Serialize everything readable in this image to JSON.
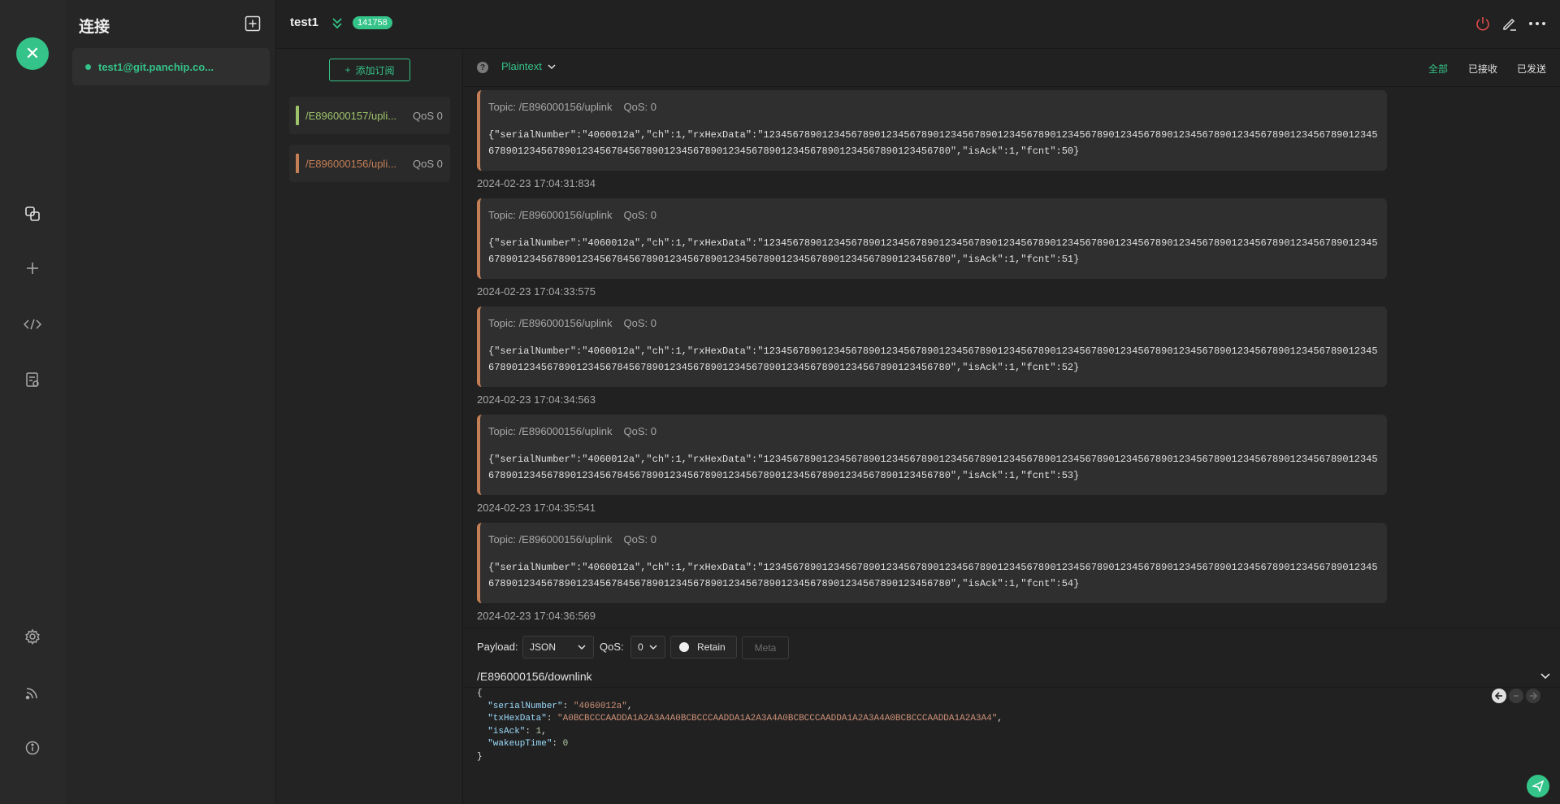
{
  "app": {
    "logo_glyph": "✕",
    "accent": "#34c388"
  },
  "nav": {
    "icons": [
      "connections-icon",
      "new-connection-icon",
      "script-icon",
      "log-icon",
      "settings-icon",
      "subscription-feed-icon",
      "about-icon"
    ]
  },
  "connections": {
    "title": "连接",
    "items": [
      {
        "name": "test1@git.panchip.co...",
        "status": "connected",
        "status_color": "#34c388"
      }
    ]
  },
  "header": {
    "title": "test1",
    "message_count": "141758"
  },
  "subscriptions": {
    "add_label": "添加订阅",
    "items": [
      {
        "topic": "/E896000157/uplink",
        "topic_display": "/E896000157/upli...",
        "qos": "QoS 0",
        "color": "#9ec46b"
      },
      {
        "topic": "/E896000156/uplink",
        "topic_display": "/E896000156/upli...",
        "qos": "QoS 0",
        "color": "#c47f56"
      }
    ]
  },
  "toolbar": {
    "format": "Plaintext",
    "filters": [
      "全部",
      "已接收",
      "已发送"
    ],
    "active_filter": "全部"
  },
  "messages": [
    {
      "topic": "Topic: /E896000156/uplink",
      "qos": "QoS: 0",
      "payload": "{\"serialNumber\":\"4060012a\",\"ch\":1,\"rxHexData\":\"1234567890123456789012345678901234567890123456789012345678901234567890123456789012345678901234567890123456789012345678901234567845678901234567890123456789012345678901234567890123456780\",\"isAck\":1,\"fcnt\":50}",
      "time": "2024-02-23 17:04:31:834"
    },
    {
      "topic": "Topic: /E896000156/uplink",
      "qos": "QoS: 0",
      "payload": "{\"serialNumber\":\"4060012a\",\"ch\":1,\"rxHexData\":\"1234567890123456789012345678901234567890123456789012345678901234567890123456789012345678901234567890123456789012345678901234567845678901234567890123456789012345678901234567890123456780\",\"isAck\":1,\"fcnt\":51}",
      "time": "2024-02-23 17:04:33:575"
    },
    {
      "topic": "Topic: /E896000156/uplink",
      "qos": "QoS: 0",
      "payload": "{\"serialNumber\":\"4060012a\",\"ch\":1,\"rxHexData\":\"1234567890123456789012345678901234567890123456789012345678901234567890123456789012345678901234567890123456789012345678901234567845678901234567890123456789012345678901234567890123456780\",\"isAck\":1,\"fcnt\":52}",
      "time": "2024-02-23 17:04:34:563"
    },
    {
      "topic": "Topic: /E896000156/uplink",
      "qos": "QoS: 0",
      "payload": "{\"serialNumber\":\"4060012a\",\"ch\":1,\"rxHexData\":\"1234567890123456789012345678901234567890123456789012345678901234567890123456789012345678901234567890123456789012345678901234567845678901234567890123456789012345678901234567890123456780\",\"isAck\":1,\"fcnt\":53}",
      "time": "2024-02-23 17:04:35:541"
    },
    {
      "topic": "Topic: /E896000156/uplink",
      "qos": "QoS: 0",
      "payload": "{\"serialNumber\":\"4060012a\",\"ch\":1,\"rxHexData\":\"1234567890123456789012345678901234567890123456789012345678901234567890123456789012345678901234567890123456789012345678901234567845678901234567890123456789012345678901234567890123456780\",\"isAck\":1,\"fcnt\":54}",
      "time": "2024-02-23 17:04:36:569"
    }
  ],
  "publish": {
    "payload_label": "Payload:",
    "payload_format": "JSON",
    "qos_label": "QoS:",
    "qos_value": "0",
    "retain_label": "Retain",
    "meta_label": "Meta",
    "topic": "/E896000156/downlink",
    "editor_lines": [
      "{",
      "  \"serialNumber\": \"4060012a\",",
      "  \"txHexData\": \"A0BCBCCCAADDA1A2A3A4A0BCBCCCAADDA1A2A3A4A0BCBCCCAADDA1A2A3A4A0BCBCCCAADDA1A2A3A4\",",
      "  \"isAck\": 1,",
      "  \"wakeupTime\": 0",
      "}"
    ]
  }
}
